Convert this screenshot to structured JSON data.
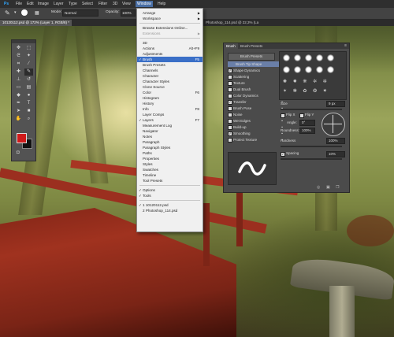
{
  "app": {
    "logo": "Ps",
    "menus": [
      "File",
      "Edit",
      "Image",
      "Layer",
      "Type",
      "Select",
      "Filter",
      "3D",
      "View",
      "Window",
      "Help"
    ],
    "active_menu": "Window"
  },
  "options_bar": {
    "mode_label": "Mode:",
    "mode_value": "Normal",
    "opacity_label": "Opacity:",
    "opacity_value": "100%"
  },
  "documents": [
    {
      "title": "10120112.psd @ 172% (Layer 1, RGB/8) *",
      "active": true
    },
    {
      "title": "Photoshop_114.psd @ 22,3% (La",
      "active": false
    }
  ],
  "toolbox": {
    "tools": [
      "move-icon",
      "marquee-icon",
      "lasso-icon",
      "magic-wand-icon",
      "crop-icon",
      "eyedropper-icon",
      "healing-icon",
      "brush-icon",
      "stamp-icon",
      "history-brush-icon",
      "eraser-icon",
      "gradient-icon",
      "blur-icon",
      "dodge-icon",
      "pen-icon",
      "type-icon",
      "path-select-icon",
      "shape-icon",
      "hand-icon",
      "zoom-icon"
    ],
    "foreground_color": "#d01a1a",
    "background_color": "#111111"
  },
  "window_menu": {
    "items": [
      {
        "label": "Arrange",
        "submenu": true
      },
      {
        "label": "Workspace",
        "submenu": true
      },
      {
        "sep": true
      },
      {
        "label": "Browse Extensions Online..."
      },
      {
        "label": "Extensions",
        "disabled": true,
        "submenu": true
      },
      {
        "sep": true
      },
      {
        "label": "3D"
      },
      {
        "label": "Actions",
        "shortcut": "Alt+F9"
      },
      {
        "label": "Adjustments"
      },
      {
        "label": "Brush",
        "shortcut": "F5",
        "checked": true,
        "highlighted": true
      },
      {
        "label": "Brush Presets"
      },
      {
        "label": "Channels"
      },
      {
        "label": "Character"
      },
      {
        "label": "Character Styles"
      },
      {
        "label": "Clone Source"
      },
      {
        "label": "Color",
        "shortcut": "F6"
      },
      {
        "label": "Histogram"
      },
      {
        "label": "History"
      },
      {
        "label": "Info",
        "shortcut": "F8"
      },
      {
        "label": "Layer Comps"
      },
      {
        "label": "Layers",
        "shortcut": "F7",
        "checked": true
      },
      {
        "label": "Measurement Log"
      },
      {
        "label": "Navigator"
      },
      {
        "label": "Notes"
      },
      {
        "label": "Paragraph"
      },
      {
        "label": "Paragraph Styles"
      },
      {
        "label": "Paths"
      },
      {
        "label": "Properties"
      },
      {
        "label": "Styles"
      },
      {
        "label": "Swatches"
      },
      {
        "label": "Timeline"
      },
      {
        "label": "Tool Presets"
      },
      {
        "sep": true
      },
      {
        "label": "Options",
        "checked": true
      },
      {
        "label": "Tools",
        "checked": true
      },
      {
        "sep": true
      },
      {
        "label": "1 10120112.psd",
        "checked": true
      },
      {
        "label": "2 Photoshop_114.psd"
      }
    ]
  },
  "brush_panel": {
    "tabs": [
      "Brush",
      "Brush Presets"
    ],
    "presets_button": "Brush Presets",
    "options": [
      {
        "label": "Brush Tip Shape",
        "header": true
      },
      {
        "label": "Shape Dynamics",
        "checked": true
      },
      {
        "label": "Scattering",
        "checked": false
      },
      {
        "label": "Texture",
        "checked": false
      },
      {
        "label": "Dual Brush",
        "checked": false
      },
      {
        "label": "Color Dynamics",
        "checked": false
      },
      {
        "label": "Transfer",
        "checked": true
      },
      {
        "label": "Brush Pose",
        "checked": false
      },
      {
        "label": "Noise",
        "checked": false
      },
      {
        "label": "Wet Edges",
        "checked": false
      },
      {
        "label": "Build-up",
        "checked": false
      },
      {
        "label": "Smoothing",
        "checked": true
      },
      {
        "label": "Protect Texture",
        "checked": false
      }
    ],
    "size_label": "Size",
    "size_value": "9 px",
    "flip_x": "Flip X",
    "flip_y": "Flip Y",
    "angle_label": "Angle:",
    "angle_value": "0°",
    "roundness_label": "Roundness:",
    "roundness_value": "100%",
    "hardness_label": "Hardness",
    "hardness_value": "100%",
    "spacing_label": "Spacing",
    "spacing_value": "10%"
  }
}
